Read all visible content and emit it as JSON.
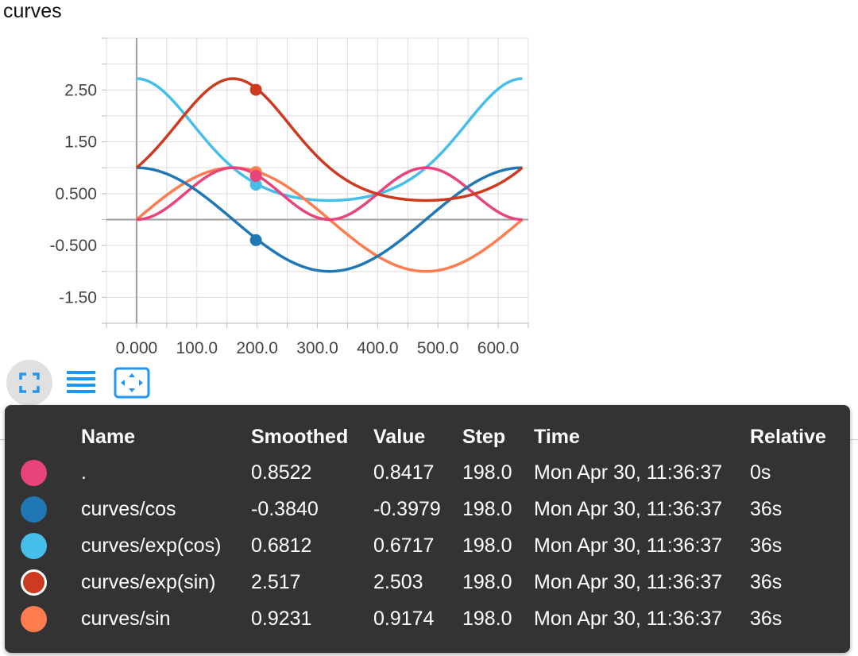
{
  "card": {
    "title": "curves"
  },
  "toolbar": {
    "buttons": [
      {
        "name": "expand",
        "icon": "fullscreen-icon",
        "active": true
      },
      {
        "name": "log-scale",
        "icon": "lines-icon",
        "active": false
      },
      {
        "name": "fit-domain",
        "icon": "fit-domain-icon",
        "active": false
      }
    ]
  },
  "chart_data": {
    "type": "line",
    "x_range": [
      -50,
      650
    ],
    "y_range": [
      -2,
      3.5
    ],
    "x_ticks": [
      "0.000",
      "100.0",
      "200.0",
      "300.0",
      "400.0",
      "500.0",
      "600.0"
    ],
    "x_tick_values": [
      0,
      100,
      200,
      300,
      400,
      500,
      600
    ],
    "y_ticks": [
      "2.50",
      "1.50",
      "0.500",
      "-0.500",
      "-1.50"
    ],
    "y_tick_values": [
      2.5,
      1.5,
      0.5,
      -0.5,
      -1.5
    ],
    "grid": true,
    "hover_step": 198.0,
    "series": [
      {
        "name": ".",
        "color": "#e8437b",
        "function": "sin2",
        "hover_value": 0.8417
      },
      {
        "name": "curves/cos",
        "color": "#1f77b4",
        "function": "cos",
        "hover_value": -0.3979
      },
      {
        "name": "curves/exp(cos)",
        "color": "#45bfea",
        "function": "exp_cos",
        "hover_value": 0.6717
      },
      {
        "name": "curves/exp(sin)",
        "color": "#cc3a1f",
        "function": "exp_sin",
        "hover_value": 2.503
      },
      {
        "name": "curves/sin",
        "color": "#ff7c4f",
        "function": "sin",
        "hover_value": 0.9174
      }
    ]
  },
  "tooltip": {
    "headers": {
      "name": "Name",
      "smoothed": "Smoothed",
      "value": "Value",
      "step": "Step",
      "time": "Time",
      "relative": "Relative"
    },
    "rows": [
      {
        "color": "#e8437b",
        "ring": false,
        "name": ".",
        "smoothed": "0.8522",
        "value": "0.8417",
        "step": "198.0",
        "time": "Mon Apr 30, 11:36:37",
        "relative": "0s"
      },
      {
        "color": "#1f77b4",
        "ring": false,
        "name": "curves/cos",
        "smoothed": "-0.3840",
        "value": "-0.3979",
        "step": "198.0",
        "time": "Mon Apr 30, 11:36:37",
        "relative": "36s"
      },
      {
        "color": "#45bfea",
        "ring": false,
        "name": "curves/exp(cos)",
        "smoothed": "0.6812",
        "value": "0.6717",
        "step": "198.0",
        "time": "Mon Apr 30, 11:36:37",
        "relative": "36s"
      },
      {
        "color": "#cc3a1f",
        "ring": true,
        "name": "curves/exp(sin)",
        "smoothed": "2.517",
        "value": "2.503",
        "step": "198.0",
        "time": "Mon Apr 30, 11:36:37",
        "relative": "36s"
      },
      {
        "color": "#ff7c4f",
        "ring": false,
        "name": "curves/sin",
        "smoothed": "0.9231",
        "value": "0.9174",
        "step": "198.0",
        "time": "Mon Apr 30, 11:36:37",
        "relative": "36s"
      }
    ]
  }
}
